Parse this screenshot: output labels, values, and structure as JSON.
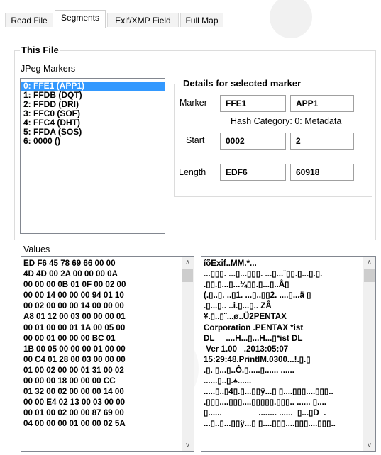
{
  "tabs": [
    {
      "label": "Read File"
    },
    {
      "label": "Segments"
    },
    {
      "label": "Exif/XMP Field"
    },
    {
      "label": "Full Map"
    }
  ],
  "active_tab": "Segments",
  "this_file": {
    "title": "This File",
    "markers_label": "JPeg Markers",
    "markers": [
      "0: FFE1  (APP1)",
      "1: FFDB  (DQT)",
      "2: FFDD  (DRI)",
      "3: FFC0  (SOF)",
      "4: FFC4  (DHT)",
      "5: FFDA  (SOS)",
      "6: 0000  ()"
    ],
    "selected_index": 0
  },
  "details": {
    "title": "Details for selected marker",
    "marker_label": "Marker",
    "marker_hex": "FFE1",
    "marker_name": "APP1",
    "hash_category": "Hash Category: 0: Metadata",
    "start_label": "Start",
    "start_hex": "0002",
    "start_dec": "2",
    "length_label": "Length",
    "length_hex": "EDF6",
    "length_dec": "60918"
  },
  "values": {
    "label": "Values",
    "hex_lines": [
      "ED F6 45 78 69 66 00 00",
      "4D 4D 00 2A 00 00 00 0A",
      "00 00 00 0B 01 0F 00 02 00",
      "00 00 14 00 00 00 94 01 10",
      "00 02 00 00 00 14 00 00 00",
      "A8 01 12 00 03 00 00 00 01",
      "00 01 00 00 01 1A 00 05 00",
      "00 00 01 00 00 00 BC 01",
      "1B 00 05 00 00 00 01 00 00",
      "00 C4 01 28 00 03 00 00 00",
      "01 00 02 00 00 01 31 00 02",
      "00 00 00 18 00 00 00 CC",
      "01 32 00 02 00 00 00 14 00",
      "00 00 E4 02 13 00 03 00 00",
      "00 01 00 02 00 00 87 69 00",
      "04 00 00 00 01 00 00 02 5A"
    ],
    "ascii_lines": [
      "íõExif..MM.*...",
      "...▯▯▯. ...▯...▯▯▯. ...▯...¨▯▯.▯...▯.▯.",
      ".▯▯.▯...▯...¼▯▯.▯...▯..Å▯",
      "(.▯..▯. ..▯1. ...▯..▯▯2. ....▯...ä ▯",
      ".▯...▯.. ..i.▯...▯.. ZÂ",
      "¥.▯..▯¨...ø..Ü2PENTAX",
      "Corporation .PENTAX *ist",
      "DL     ....H...▯...H...▯*ist DL",
      " Ver 1.00   .2013:05:07",
      "15:29:48.PrintIM.0300...!.▯.▯",
      ".▯. ▯...▯..Ô.▯.....▯...... ......",
      "......▯..▯.♠......",
      ".....▯..▯4▯.▯...▯▯ÿ...▯ ▯....▯▯▯....▯▯▯..",
      ".▯▯▯....▯▯▯....▯▯▯▯▯.▯▯▯.. ...... ▯....",
      "▯......                ........ ......  ▯...▯D  .",
      "...▯..▯...▯▯ÿ...▯ ▯....▯▯▯....▯▯▯....▯▯▯.."
    ]
  }
}
